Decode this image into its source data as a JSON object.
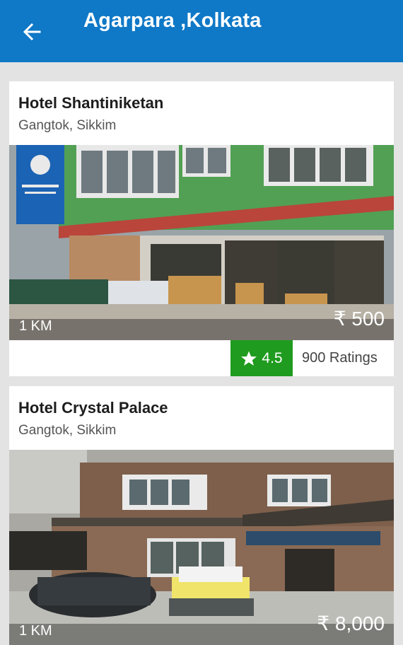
{
  "header": {
    "title": "Agarpara ,Kolkata",
    "back_icon": "arrow-left-icon"
  },
  "colors": {
    "appbar": "#0f78c7",
    "rating": "#1f9b1f"
  },
  "hotels": [
    {
      "name": "Hotel Shantiniketan",
      "location": "Gangtok, Sikkim",
      "distance": "1 KM",
      "price": "₹ 500",
      "rating": "4.5",
      "ratings_count": "900 Ratings"
    },
    {
      "name": "Hotel Crystal Palace",
      "location": "Gangtok, Sikkim",
      "distance": "1 KM",
      "price": "₹ 8,000"
    }
  ]
}
